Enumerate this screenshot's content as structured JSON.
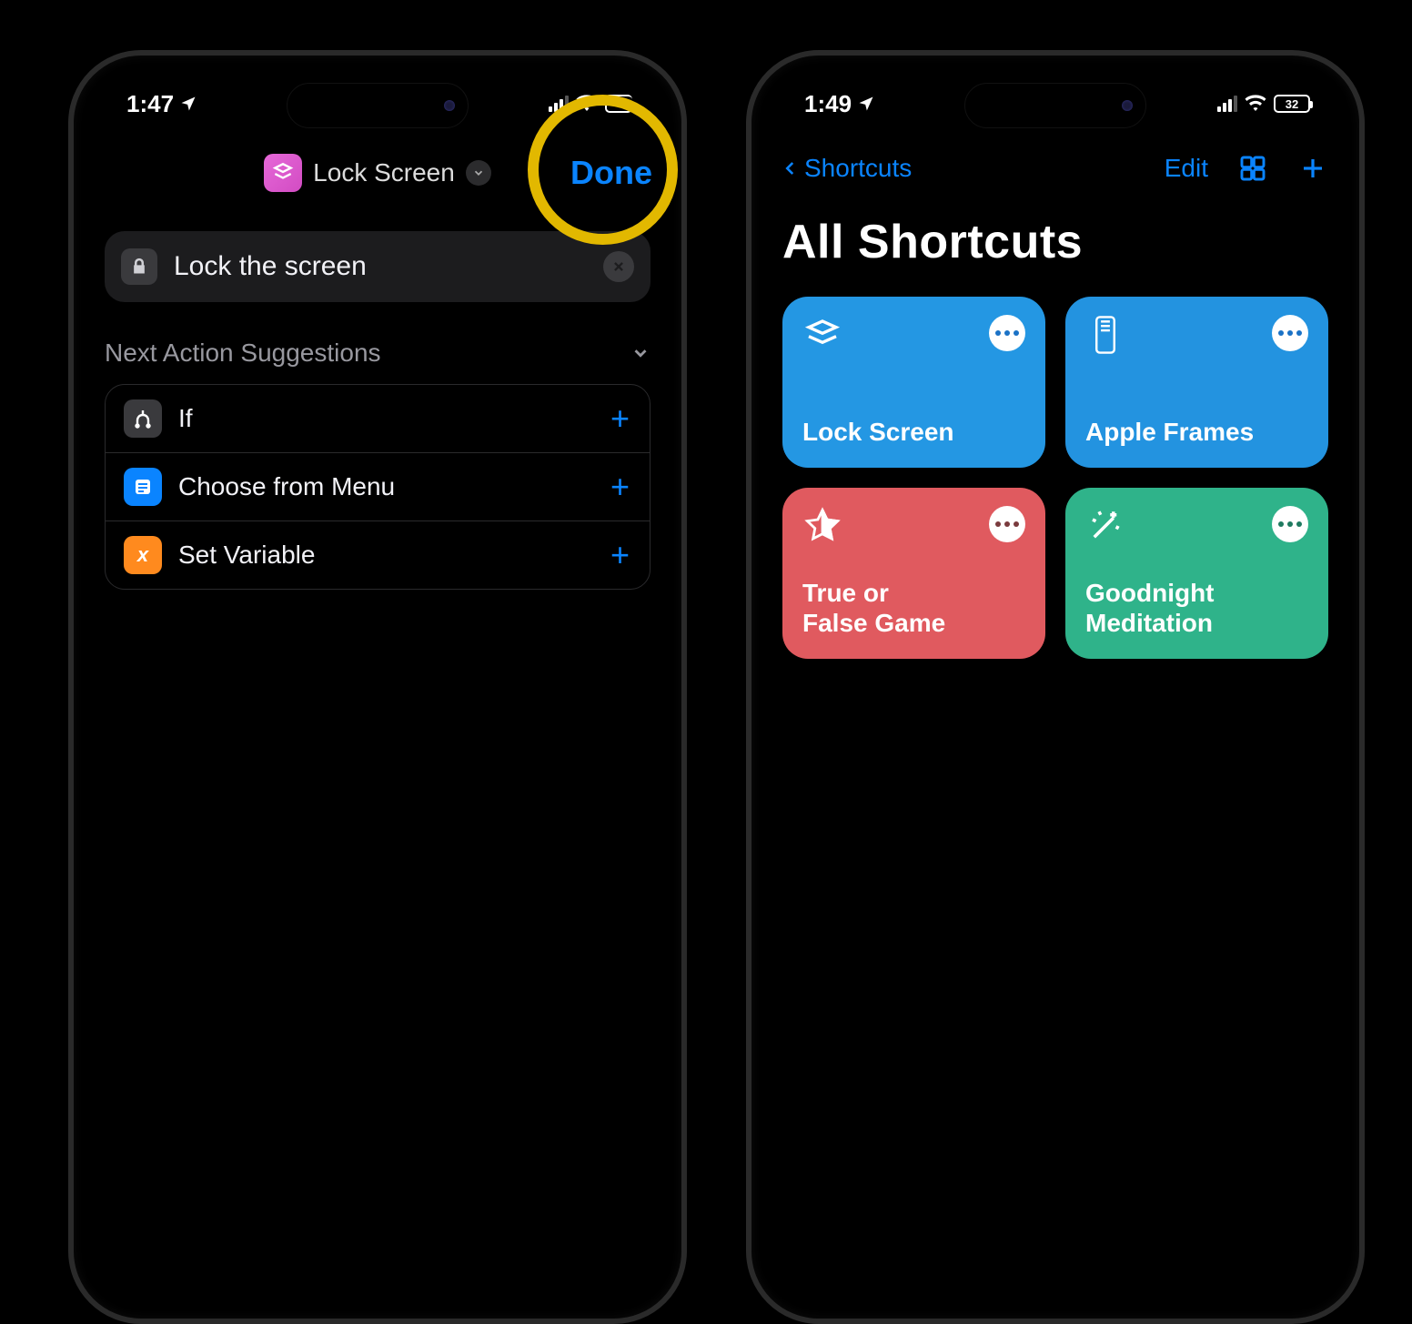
{
  "left": {
    "status_time": "1:47",
    "title_label": "Lock Screen",
    "done_label": "Done",
    "action_label": "Lock the screen",
    "suggestions_header": "Next Action Suggestions",
    "suggestions": [
      {
        "label": "If"
      },
      {
        "label": "Choose from Menu"
      },
      {
        "label": "Set Variable"
      }
    ]
  },
  "right": {
    "status_time": "1:49",
    "battery_pct": "32",
    "back_label": "Shortcuts",
    "edit_label": "Edit",
    "page_title": "All Shortcuts",
    "cards": [
      {
        "label": "Lock Screen",
        "color": "c-blue"
      },
      {
        "label": "Apple Frames",
        "color": "c-blue2"
      },
      {
        "label": "True or\nFalse Game",
        "color": "c-red"
      },
      {
        "label": "Goodnight\nMeditation",
        "color": "c-green"
      }
    ]
  },
  "colors": {
    "accent_blue": "#0a84ff",
    "highlight_ring": "#e2b800"
  }
}
